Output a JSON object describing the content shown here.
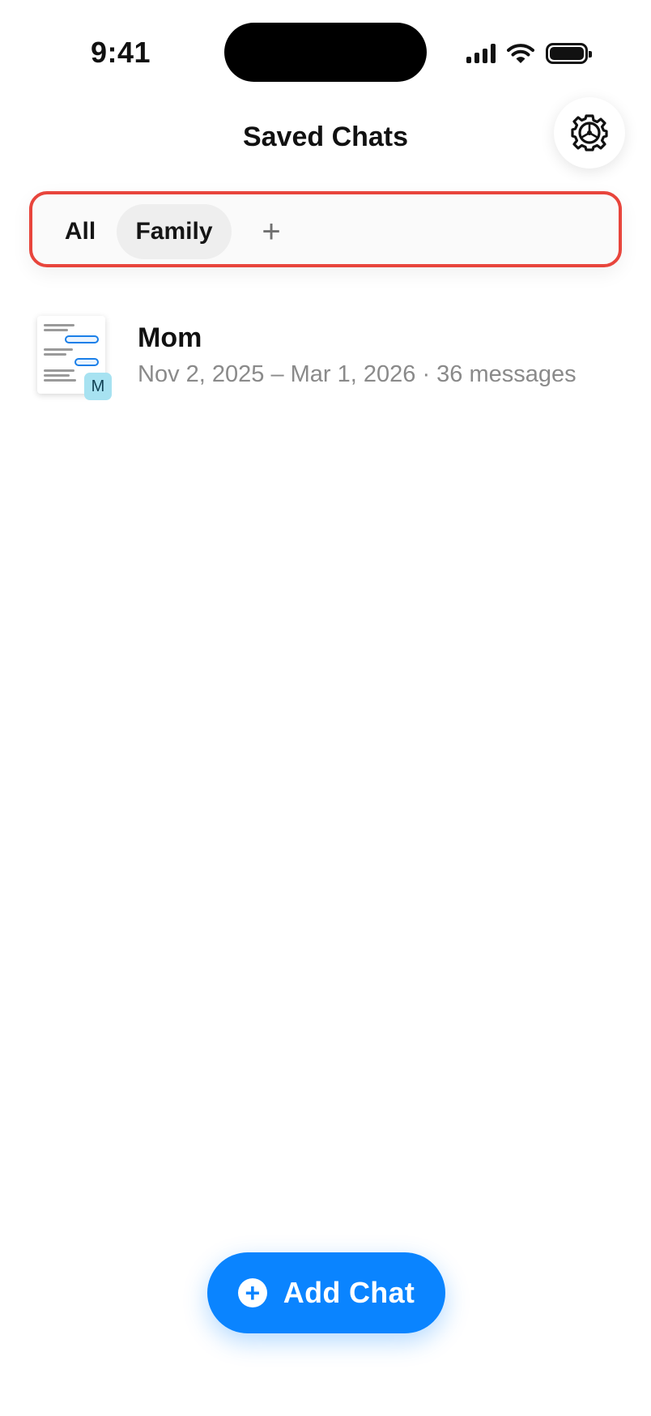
{
  "status_bar": {
    "time": "9:41",
    "icons": [
      "cellular-signal-icon",
      "wifi-icon",
      "battery-icon"
    ]
  },
  "header": {
    "title": "Saved Chats",
    "settings_icon": "gear-icon"
  },
  "filters": {
    "tabs": [
      {
        "label": "All",
        "selected": false
      },
      {
        "label": "Family",
        "selected": true
      }
    ],
    "add_label": "+"
  },
  "chats": [
    {
      "title": "Mom",
      "meta": "Nov 2, 2025 – Mar 1, 2026 · 36 messages",
      "avatar_initial": "M"
    }
  ],
  "add_chat": {
    "label": "Add Chat",
    "icon": "plus-circle-icon"
  },
  "colors": {
    "accent": "#0a84ff",
    "highlight_border": "#e8453c",
    "avatar_bg": "#a7e2f1"
  }
}
